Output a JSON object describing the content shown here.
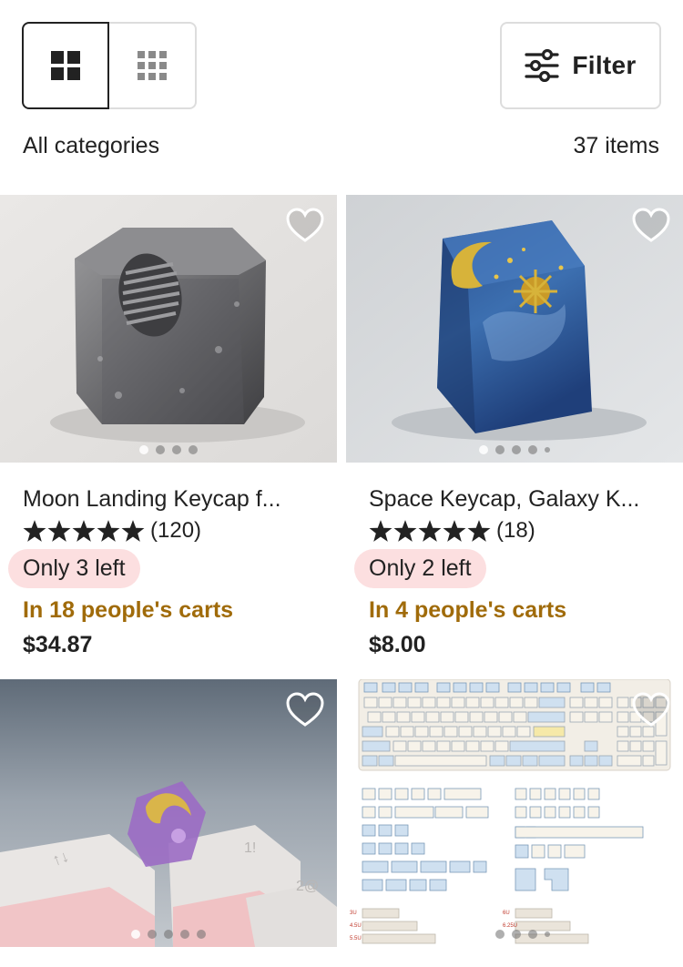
{
  "toolbar": {
    "filter_label": "Filter",
    "category_label": "All categories",
    "item_count": "37 items",
    "view_options": [
      "grid-large-icon",
      "grid-small-icon"
    ],
    "active_view": "grid-large-icon"
  },
  "listings": [
    {
      "title": "Moon Landing Keycap f...",
      "rating_stars": 5,
      "review_count": "(120)",
      "stock": "Only 3 left",
      "carts": "In 18 people's carts",
      "price": "$34.87",
      "image_dots": 4,
      "favorite_icon": "heart-outline-icon"
    },
    {
      "title": "Space Keycap, Galaxy K...",
      "rating_stars": 5,
      "review_count": "(18)",
      "stock": "Only 2 left",
      "carts": "In 4 people's carts",
      "price": "$8.00",
      "image_dots": 5,
      "favorite_icon": "heart-outline-icon"
    },
    {
      "image_dots": 5,
      "favorite_icon": "heart-outline-icon"
    },
    {
      "image_dots": 5,
      "favorite_icon": "heart-outline-icon"
    }
  ],
  "colors": {
    "badge_background": "#fcdfe0",
    "carts_text": "#a06b0a",
    "border": "#dddddd",
    "text": "#222222"
  }
}
